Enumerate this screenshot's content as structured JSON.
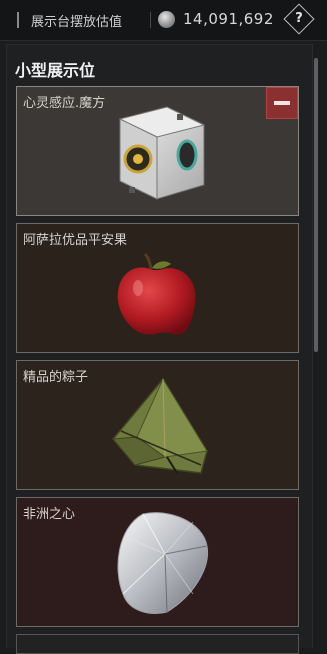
{
  "header": {
    "title": "展示台摆放估值",
    "value": "14,091,692",
    "help_label": "?"
  },
  "section": {
    "title": "小型展示位"
  },
  "slots": [
    {
      "label": "心灵感应.魔方",
      "icon": "cube-icon"
    },
    {
      "label": "阿萨拉优品平安果",
      "icon": "apple-icon"
    },
    {
      "label": "精品的粽子",
      "icon": "zongzi-icon"
    },
    {
      "label": "非洲之心",
      "icon": "diamond-icon"
    }
  ]
}
